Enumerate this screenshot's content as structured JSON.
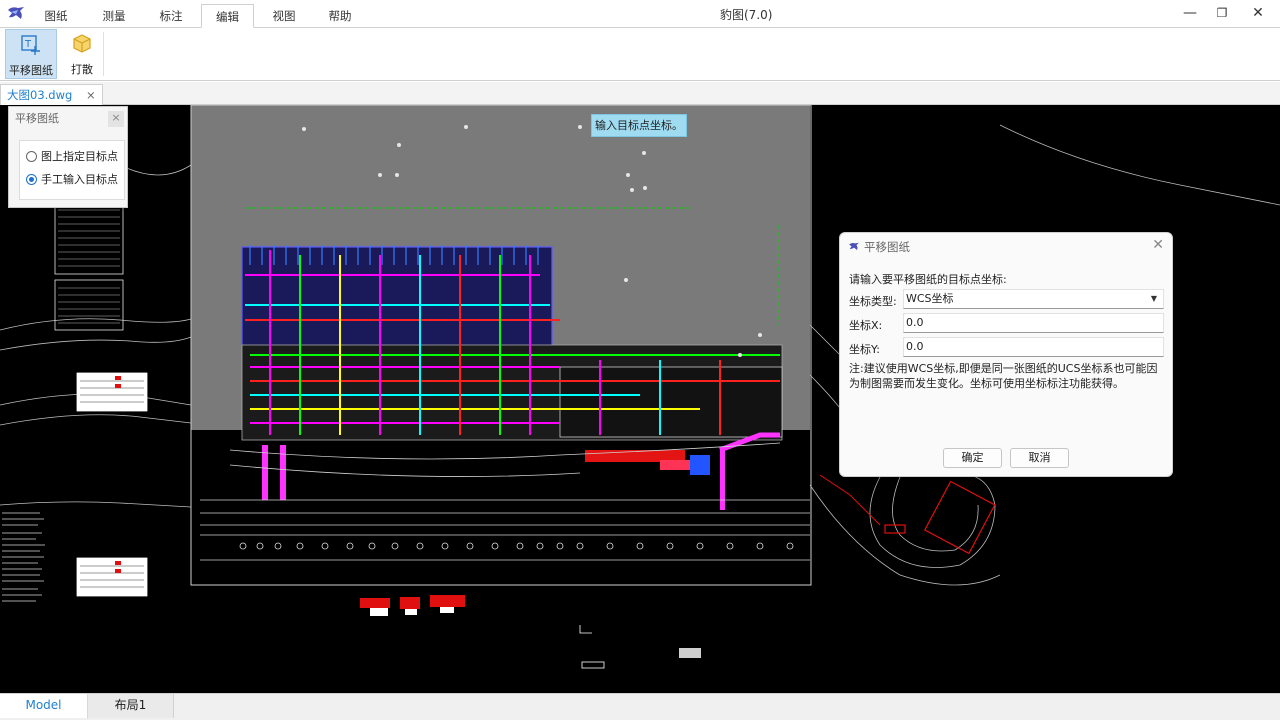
{
  "app": {
    "title": "豹图(7.0)"
  },
  "menu": {
    "tabs": [
      {
        "label": "图纸"
      },
      {
        "label": "测量"
      },
      {
        "label": "标注"
      },
      {
        "label": "编辑",
        "active": true
      },
      {
        "label": "视图"
      },
      {
        "label": "帮助"
      }
    ]
  },
  "window_controls": {
    "minimize": "—",
    "restore": "❐",
    "close": "✕"
  },
  "ribbon": {
    "buttons": [
      {
        "label": "平移图纸",
        "icon": "move-drawing-icon",
        "active": true
      },
      {
        "label": "打散",
        "icon": "explode-cube-icon",
        "active": false
      }
    ]
  },
  "document_tabs": [
    {
      "label": "大图03.dwg",
      "close": "×"
    }
  ],
  "move_panel": {
    "title": "平移图纸",
    "close": "×",
    "options": [
      {
        "label": "图上指定目标点",
        "checked": false
      },
      {
        "label": "手工输入目标点",
        "checked": true
      }
    ]
  },
  "tooltip": {
    "text": "输入目标点坐标。"
  },
  "dialog": {
    "title": "平移图纸",
    "close": "✕",
    "prompt": "请输入要平移图纸的目标点坐标:",
    "coord_type_label": "坐标类型:",
    "coord_type_value": "WCS坐标",
    "x_label": "坐标X:",
    "x_value": "0.0",
    "y_label": "坐标Y:",
    "y_value": "0.0",
    "note": "注:建议使用WCS坐标,即便是同一张图纸的UCS坐标系也可能因为制图需要而发生变化。坐标可使用坐标标注功能获得。",
    "ok_label": "确定",
    "cancel_label": "取消"
  },
  "layout_tabs": [
    {
      "label": "Model",
      "active": true
    },
    {
      "label": "布局1",
      "active": false
    }
  ],
  "colors": {
    "accent": "#1e7fd0",
    "ribbon_active": "#cde3f5",
    "tooltip": "#9fdcf2",
    "canvas": "#000000",
    "sheet": "#7a7a7a"
  }
}
